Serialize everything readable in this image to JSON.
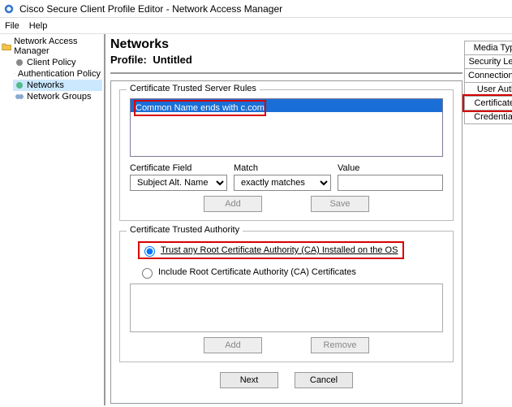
{
  "window": {
    "title": "Cisco Secure Client Profile Editor - Network Access Manager"
  },
  "menubar": {
    "file": "File",
    "help": "Help"
  },
  "sidebar": {
    "root": "Network Access Manager",
    "items": [
      {
        "label": "Client Policy"
      },
      {
        "label": "Authentication Policy"
      },
      {
        "label": "Networks",
        "selected": true
      },
      {
        "label": "Network Groups"
      }
    ]
  },
  "header": {
    "title": "Networks",
    "profile_label": "Profile:",
    "profile_value": "Untitled"
  },
  "right_tabs": [
    {
      "label": "Media Type"
    },
    {
      "label": "Security Level"
    },
    {
      "label": "Connection Type"
    },
    {
      "label": "User Auth"
    },
    {
      "label": "Certificates",
      "highlight": true
    },
    {
      "label": "Credentials"
    }
  ],
  "rules_group": {
    "title": "Certificate Trusted Server Rules",
    "rows": [
      {
        "text": "Common Name ends with c.com",
        "selected": true
      }
    ],
    "cert_field_label": "Certificate Field",
    "cert_field_value": "Subject Alt. Name",
    "match_label": "Match",
    "match_value": "exactly matches",
    "value_label": "Value",
    "value_text": "",
    "add_btn": "Add",
    "save_btn": "Save"
  },
  "ca_group": {
    "title": "Certificate Trusted Authority",
    "radio_trust": "Trust any Root Certificate Authority (CA) Installed on the OS",
    "radio_include": "Include Root Certificate Authority (CA) Certificates",
    "add_btn": "Add",
    "remove_btn": "Remove"
  },
  "nav": {
    "next": "Next",
    "cancel": "Cancel"
  }
}
